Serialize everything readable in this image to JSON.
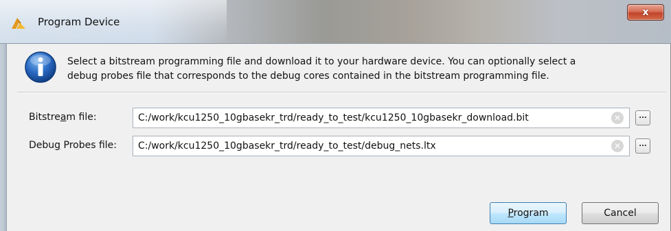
{
  "window": {
    "title": "Program Device",
    "close_glyph": "x",
    "icon_name": "vivado-logo-icon"
  },
  "info": {
    "icon_name": "info-icon",
    "line1": "Select a bitstream programming file and download it to your hardware device. You can optionally select a",
    "line2": "debug probes file that corresponds to the debug cores contained in the bitstream programming file."
  },
  "fields": {
    "bitstream": {
      "label_pre": "Bitstre",
      "label_accel": "a",
      "label_post": "m file:",
      "value": "C:/work/kcu1250_10gbasekr_trd/ready_to_test/kcu1250_10gbasekr_download.bit",
      "clear_icon": "clear-icon",
      "browse_label": "..."
    },
    "probes": {
      "label_pre": "Debu",
      "label_accel": "g",
      "label_post": " Probes file:",
      "value": "C:/work/kcu1250_10gbasekr_trd/ready_to_test/debug_nets.ltx",
      "clear_icon": "clear-icon",
      "browse_label": "..."
    }
  },
  "buttons": {
    "program_accel": "P",
    "program_rest": "rogram",
    "cancel": "Cancel"
  },
  "colors": {
    "close_button": "#c9482c",
    "program_button_border": "#3c7fb1",
    "info_icon": "#2a6bc4"
  }
}
